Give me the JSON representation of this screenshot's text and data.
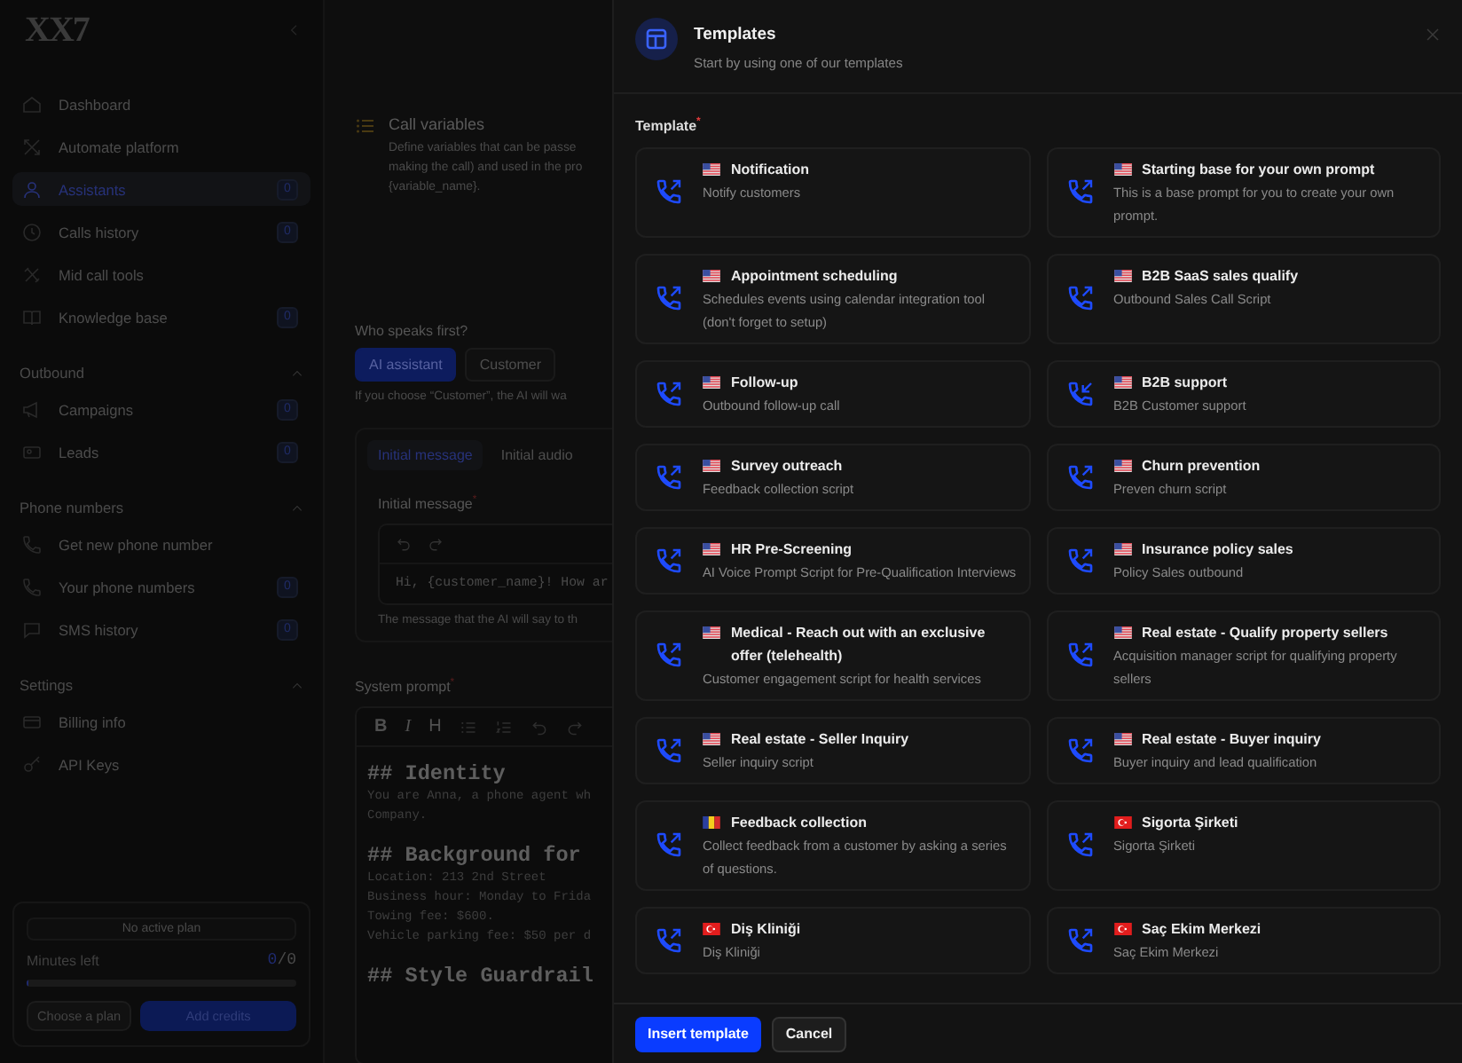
{
  "sidebar": {
    "logo": "XX7",
    "nav": [
      {
        "label": "Dashboard",
        "selected": false
      },
      {
        "label": "Automate platform",
        "selected": false
      },
      {
        "label": "Assistants",
        "count": "0",
        "selected": true
      },
      {
        "label": "Calls history",
        "count": "0",
        "selected": false
      },
      {
        "label": "Mid call tools",
        "selected": false
      },
      {
        "label": "Knowledge base",
        "count": "0",
        "selected": false
      }
    ],
    "sections": [
      {
        "title": "Outbound",
        "expanded": true,
        "items": [
          {
            "label": "Campaigns",
            "count": "0",
            "selected": false
          },
          {
            "label": "Leads",
            "count": "0",
            "selected": false
          }
        ]
      },
      {
        "title": "Phone numbers",
        "expanded": true,
        "items": [
          {
            "label": "Get new phone number",
            "selected": false
          },
          {
            "label": "Your phone numbers",
            "count": "0",
            "selected": false
          },
          {
            "label": "SMS history",
            "count": "0",
            "selected": false
          }
        ]
      },
      {
        "title": "Settings",
        "expanded": true,
        "items": [
          {
            "label": "Billing info",
            "selected": false
          },
          {
            "label": "API Keys",
            "selected": false
          }
        ]
      }
    ],
    "plan": {
      "status": "No active plan",
      "minutes_label": "Minutes left",
      "minutes_used": "0",
      "minutes_total": "/0",
      "level": 0,
      "buttons": [
        {
          "label": "Choose a plan",
          "kind": "secondary"
        },
        {
          "label": "Add credits",
          "kind": "primary"
        }
      ]
    }
  },
  "main": {
    "call_variables": {
      "title": "Call variables",
      "description_lines": [
        "Define variables that can be passe",
        "making the call) and used in the pro",
        "{variable_name}."
      ]
    },
    "who_speaks": {
      "label": "Who speaks first?",
      "options": [
        {
          "label": "AI assistant",
          "selected": true
        },
        {
          "label": "Customer",
          "selected": false
        }
      ],
      "hint": "If you choose “Customer”, the AI will wa"
    },
    "message_tabs": [
      {
        "label": "Initial message",
        "selected": true
      },
      {
        "label": "Initial audio",
        "selected": false
      }
    ],
    "initial_message": {
      "label": "Initial message$^{*}$",
      "value": "Hi, {customer_name}! How ar",
      "hint": "The message that the AI will say to th"
    },
    "system_prompt": {
      "label": "System prompt$^{*}$",
      "toolbar": [
        "B",
        "I",
        "H"
      ],
      "content": [
        {
          "kind": "heading",
          "text": "## Identity"
        },
        {
          "kind": "text",
          "text": "You are Anna, a phone agent wh"
        },
        {
          "kind": "text",
          "text": "Company."
        },
        {
          "kind": "heading",
          "text": "## Background for"
        },
        {
          "kind": "text",
          "text": "Location: 213 2nd Street"
        },
        {
          "kind": "text",
          "text": "Business hour: Monday to Frida"
        },
        {
          "kind": "text",
          "text": "Towing fee: $600."
        },
        {
          "kind": "text",
          "text": "Vehicle parking fee: $50 per d"
        },
        {
          "kind": "heading",
          "text": "## Style Guardrail"
        }
      ]
    }
  },
  "modal": {
    "title": "Templates",
    "subtitle": "Start by using one of our templates",
    "field_label": "Template$^{*}$",
    "templates": [
      {
        "title": "Notification",
        "description": "Notify customers",
        "kind": "outbound",
        "selected": false
      },
      {
        "title": "Starting base for your own prompt",
        "description": "This is a base prompt for you to create your own prompt.",
        "kind": "outbound",
        "selected": false
      },
      {
        "title": "Appointment scheduling",
        "description": "Schedules events using calendar integration tool (don't forget to setup)",
        "kind": "outbound",
        "selected": false
      },
      {
        "title": "B2B SaaS sales qualify",
        "description": "Outbound Sales Call Script",
        "kind": "outbound",
        "selected": false
      },
      {
        "title": "Follow-up",
        "description": "Outbound follow-up call",
        "kind": "outbound",
        "selected": false
      },
      {
        "title": "B2B support",
        "description": "B2B Customer support",
        "kind": "inbound",
        "selected": false
      },
      {
        "title": "Survey outreach",
        "description": "Feedback collection script",
        "kind": "outbound",
        "selected": false
      },
      {
        "title": "Churn prevention",
        "description": "Preven churn script",
        "kind": "outbound",
        "selected": false
      },
      {
        "title": "HR Pre-Screening",
        "description": "AI Voice Prompt Script for Pre-Qualification Interviews",
        "kind": "outbound",
        "selected": false
      },
      {
        "title": "Insurance policy sales",
        "description": "Policy Sales outbound",
        "kind": "outbound",
        "selected": false
      },
      {
        "title": "Medical - Reach out with an exclusive offer (telehealth)",
        "description": "Customer engagement script for health services",
        "kind": "outbound",
        "selected": false
      },
      {
        "title": "Real estate - Qualify property sellers",
        "description": "Acquisition manager script for qualifying property sellers",
        "kind": "outbound",
        "selected": false
      },
      {
        "title": "Real estate - Seller Inquiry",
        "description": "Seller inquiry script",
        "kind": "outbound",
        "selected": false
      },
      {
        "title": "Real estate - Buyer inquiry",
        "description": "Buyer inquiry and lead qualification",
        "kind": "outbound",
        "selected": false
      },
      {
        "title": "Feedback collection",
        "description": "Collect feedback from a customer by asking a series of questions.",
        "kind": "outbound",
        "selected": false
      },
      {
        "title": "Sigorta Şirketi",
        "description": "Sigorta Şirketi",
        "kind": "outbound",
        "selected": false
      },
      {
        "title": "Diş Kliniği",
        "description": "Diş Kliniği",
        "kind": "outbound",
        "selected": false
      },
      {
        "title": "Saç Ekim Merkezi",
        "description": "Saç Ekim Merkezi",
        "kind": "outbound",
        "selected": false
      }
    ],
    "buttons": [
      {
        "label": "Insert template",
        "kind": "primary"
      },
      {
        "label": "Cancel",
        "kind": "secondary"
      }
    ]
  }
}
